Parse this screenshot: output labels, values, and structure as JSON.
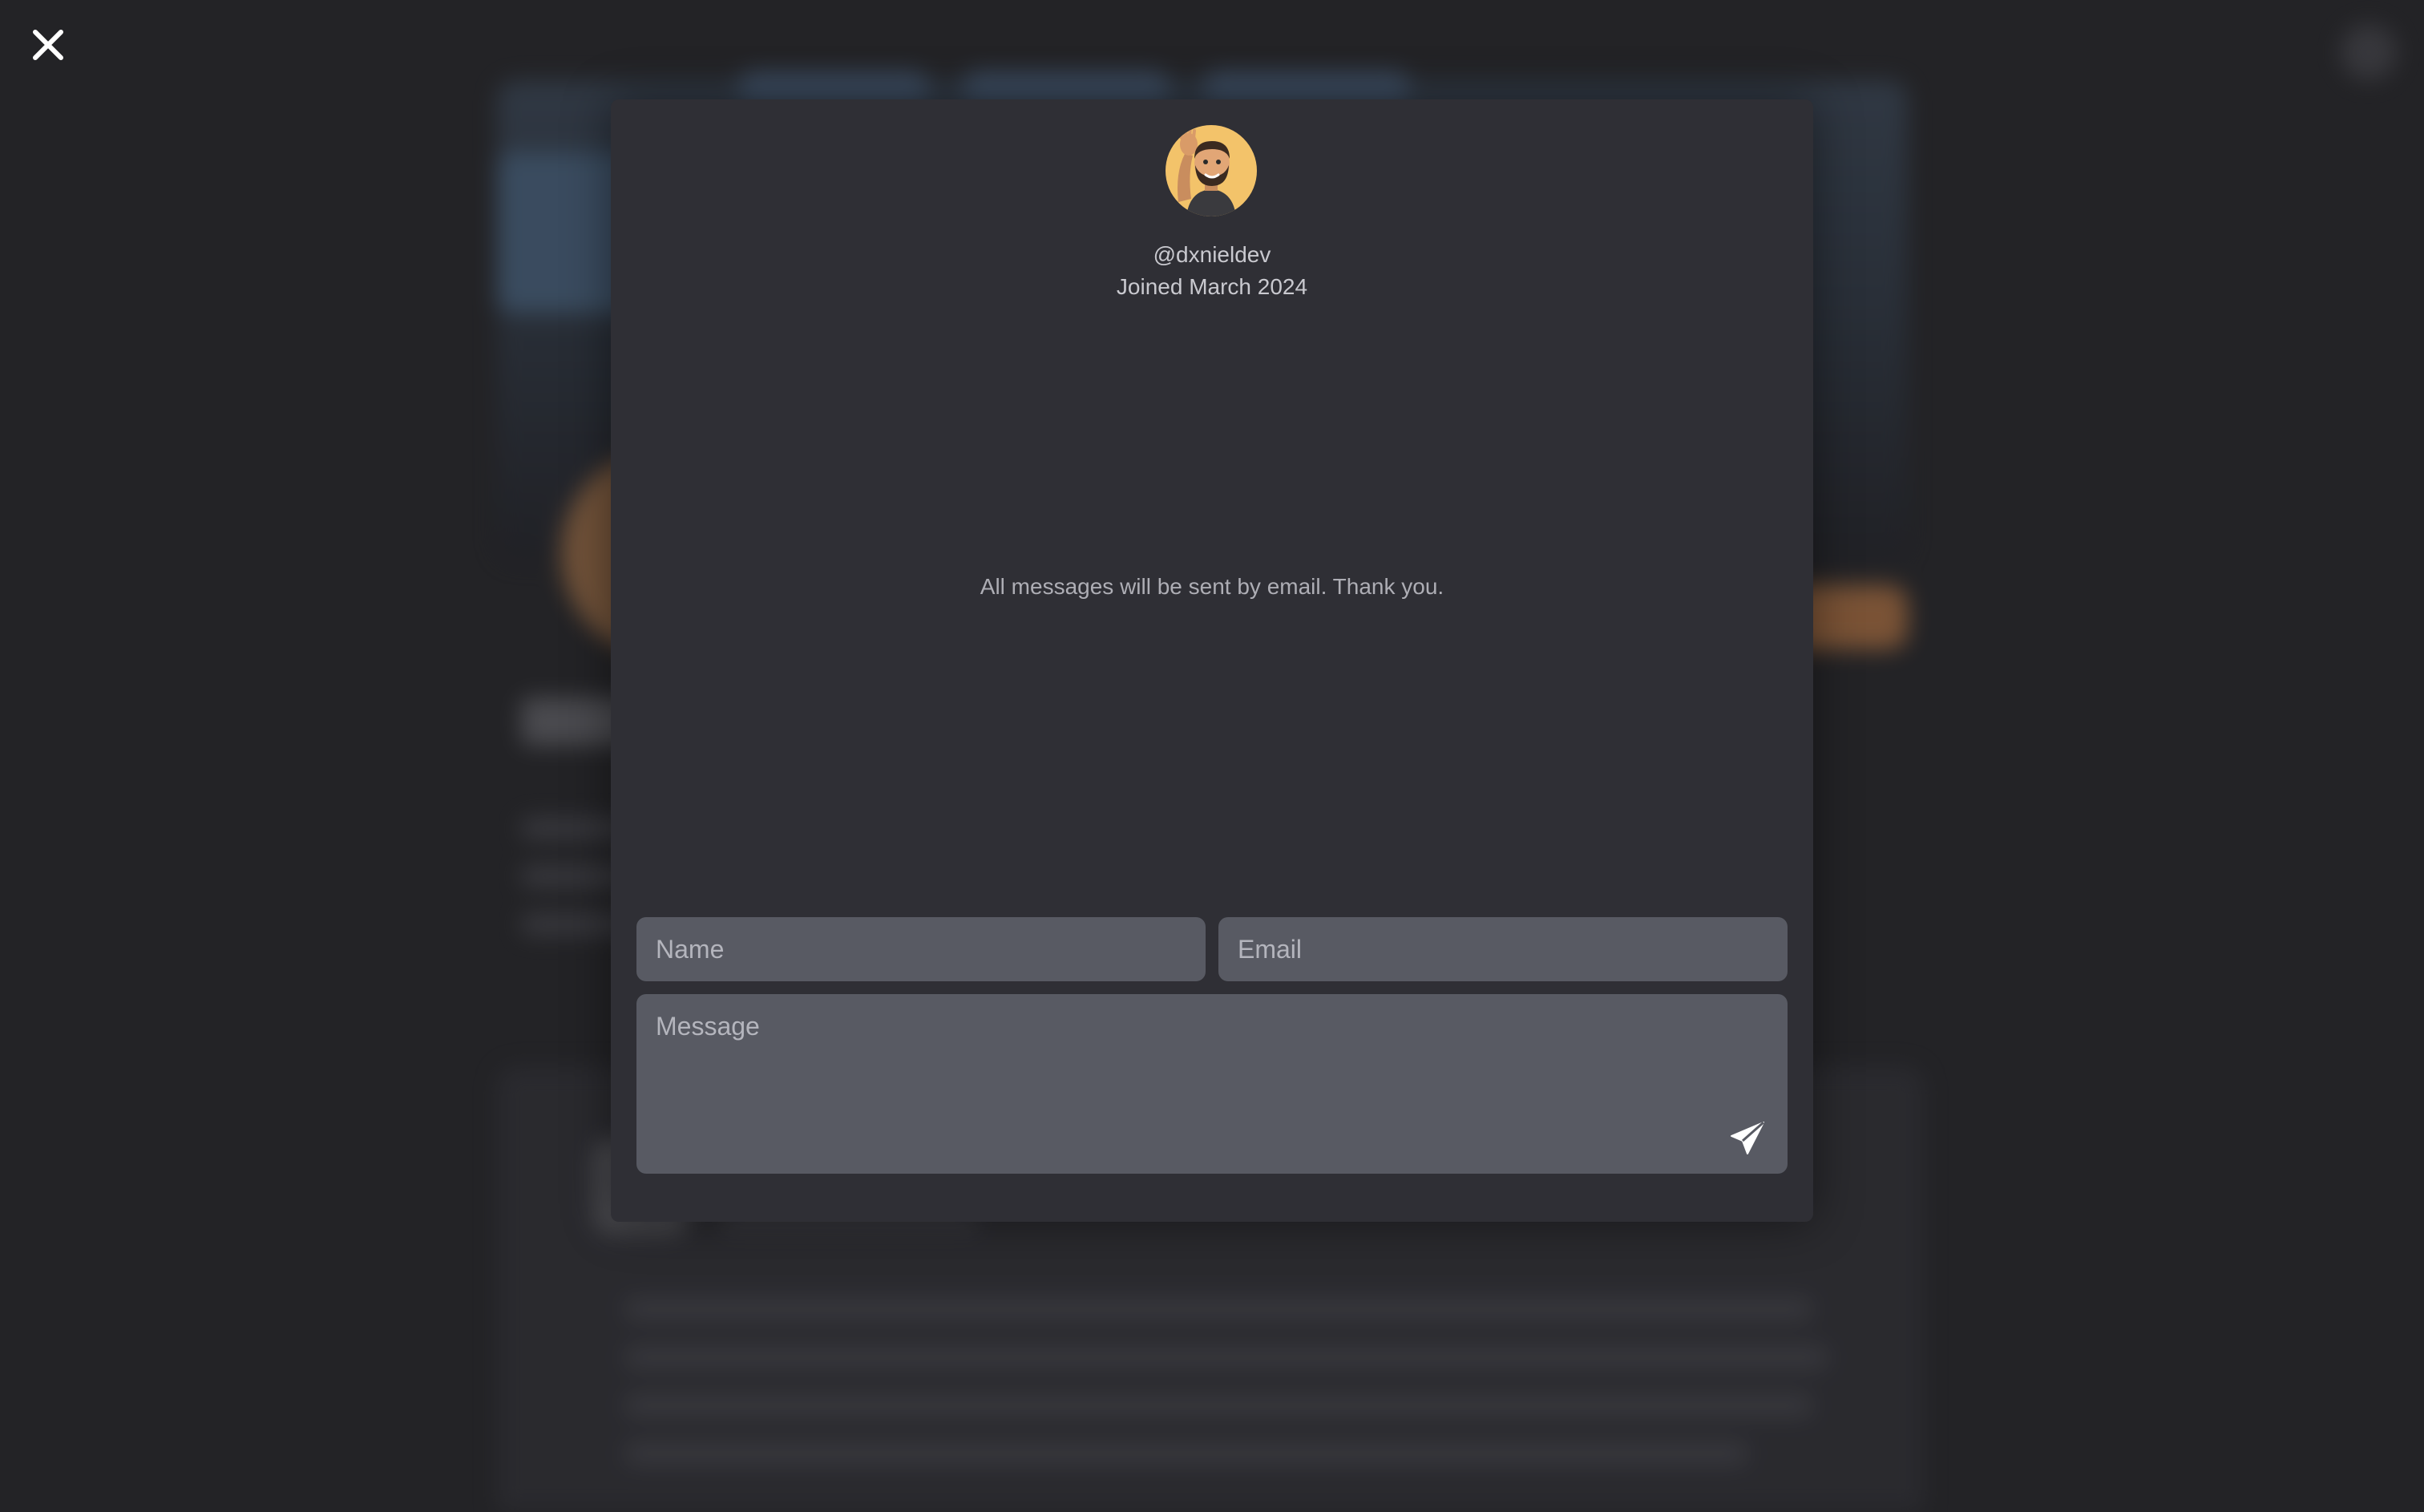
{
  "profile": {
    "handle": "@dxnieldev",
    "joined": "Joined March 2024",
    "avatar_icon": "memoji-waving-icon"
  },
  "notice": "All messages will be sent by email. Thank you.",
  "form": {
    "name_placeholder": "Name",
    "email_placeholder": "Email",
    "message_placeholder": "Message"
  },
  "icons": {
    "close": "close-icon",
    "send": "send-icon"
  },
  "colors": {
    "page_background": "#232326",
    "modal_background": "#2f2f35",
    "field_background": "#585a63",
    "avatar_background": "#f3c36a"
  }
}
